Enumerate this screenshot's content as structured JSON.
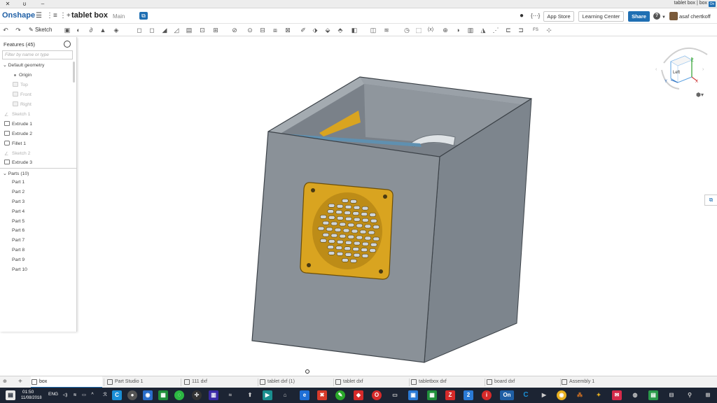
{
  "window": {
    "title": "tablet box | box",
    "badge": "On",
    "close_glyph": "✕",
    "restore_glyph": "ʊ",
    "min_glyph": "–"
  },
  "header": {
    "logo": "Onshape",
    "doc_title": "tablet box",
    "branch": "Main",
    "app_store": "App Store",
    "learning_center": "Learning Center",
    "share": "Share",
    "help": "?",
    "user": "asaf chertkoff"
  },
  "toolbar": {
    "sketch_label": "Sketch"
  },
  "features": {
    "title": "Features (45)",
    "filter_placeholder": "Filter by name or type",
    "default_geometry": "Default geometry",
    "origin": "Origin",
    "top": "Top",
    "front": "Front",
    "right": "Right",
    "items": [
      "Sketch 1",
      "Extrude 1",
      "Extrude 2",
      "Fillet 1",
      "Sketch 2",
      "Extrude 3"
    ],
    "parts_header": "Parts (10)",
    "parts": [
      "Part 1",
      "Part 2",
      "Part 3",
      "Part 4",
      "Part 5",
      "Part 6",
      "Part 7",
      "Part 8",
      "Part 9",
      "Part 10"
    ]
  },
  "view_cube": {
    "face": "Left",
    "x_axis": "X",
    "y_axis": "Y",
    "z_axis": "Z"
  },
  "tabs": {
    "add": "+",
    "items": [
      "box",
      "Part Studio 1",
      "111 dxf",
      "tablet dxf (1)",
      "tablet dxf",
      "tabletbox dxf",
      "board dxf",
      "Assembly 1"
    ]
  },
  "taskbar": {
    "time": "01:50",
    "date": "11/08/2018",
    "lang": "ENG"
  },
  "colors": {
    "brand": "#1f5fa5",
    "accent": "#1f6fb3",
    "box_body": "#7d858d",
    "box_front": "#8a9198",
    "grille": "#d9a420",
    "taskbar": "#1c2433"
  }
}
